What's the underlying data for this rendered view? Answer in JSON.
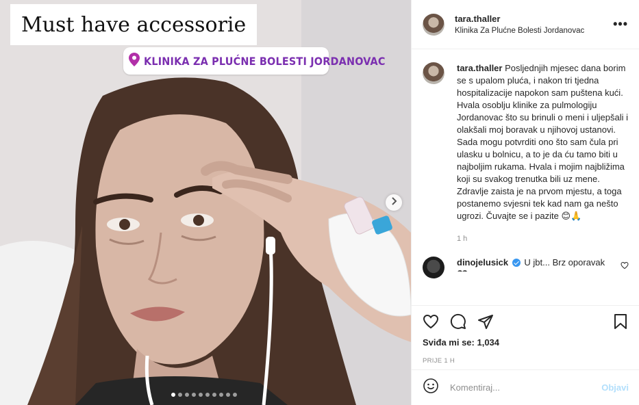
{
  "media": {
    "caption_sticker": "Must have accessorie",
    "location_sticker": "Klinika Za Plućne Bolesti Jordanovac",
    "carousel_dot_count": 10,
    "carousel_active_index": 0
  },
  "post": {
    "username": "tara.thaller",
    "location": "Klinika Za Plućne Bolesti Jordanovac",
    "more_label": "•••"
  },
  "caption": {
    "username": "tara.thaller",
    "text": "Posljednjih mjesec dana borim se s upalom pluća, i nakon tri tjedna hospitalizacije napokon sam puštena kući. Hvala osoblju klinike za pulmologiju Jordanovac što su brinuli o meni i uljepšali i olakšali moj boravak u njihovoj ustanovi. Sada mogu potvrditi ono što sam čula pri ulasku u bolnicu, a to je da ću tamo biti u najboljim rukama. Hvala i mojim najbližima koji su svakog trenutka bili uz mene. Zdravlje zaista je na prvom mjestu, a toga postanemo svjesni tek kad nam ga nešto ugrozi. Čuvajte se i pazite 😊🙏",
    "time": "1 h"
  },
  "top_comment": {
    "username": "dinojelusick",
    "text": "U jbt... Brz oporavak 🖤"
  },
  "actions": {
    "likes_label": "Sviđa mi se: 1,034",
    "posted_ago": "PRIJE 1 H"
  },
  "comment_box": {
    "placeholder": "Komentiraj...",
    "post_label": "Objavi"
  },
  "colors": {
    "location_accent": "#7b2fb0",
    "verified_blue": "#3897f0",
    "post_button_disabled": "#b2dffc"
  }
}
